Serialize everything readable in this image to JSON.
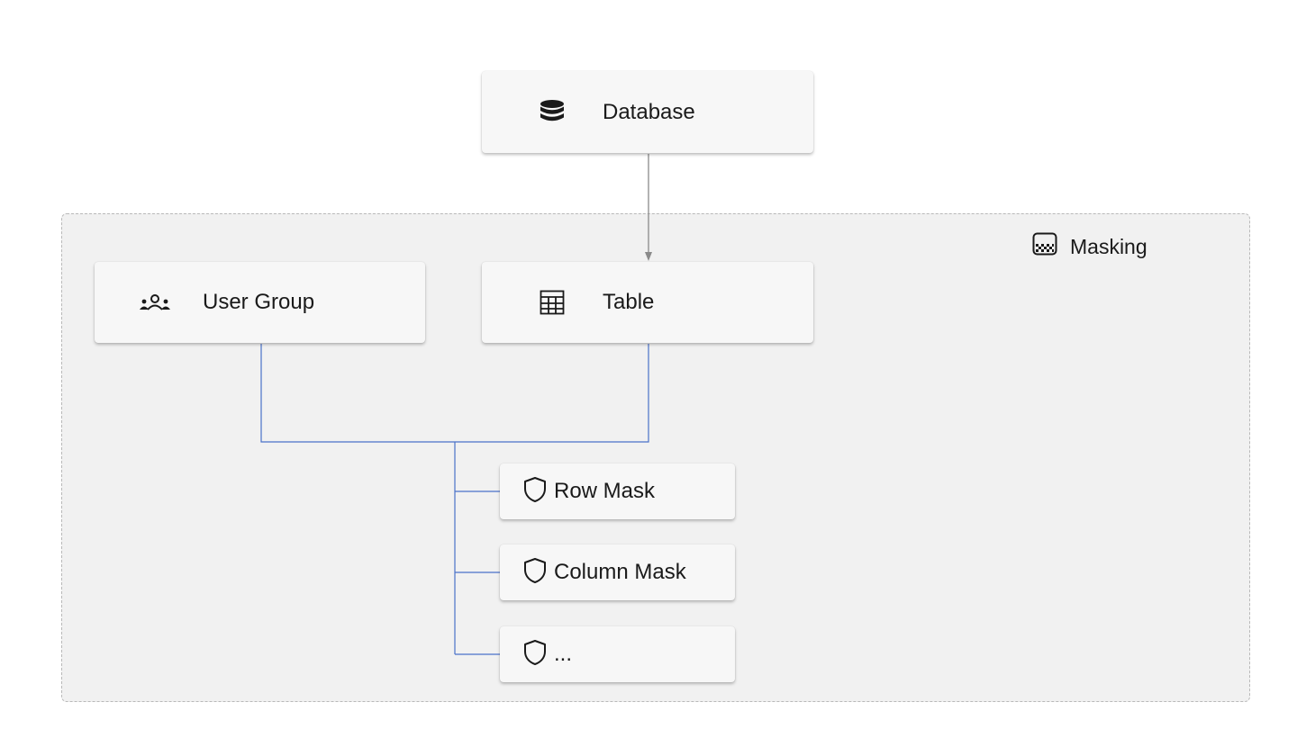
{
  "diagram": {
    "nodes": {
      "database": {
        "label": "Database",
        "icon": "database-icon"
      },
      "user_group": {
        "label": "User Group",
        "icon": "user-group-icon"
      },
      "table": {
        "label": "Table",
        "icon": "table-icon"
      },
      "masks": [
        {
          "label": "Row Mask",
          "icon": "shield-icon"
        },
        {
          "label": "Column Mask",
          "icon": "shield-icon"
        },
        {
          "label": "...",
          "icon": "shield-icon"
        }
      ]
    },
    "group": {
      "label": "Masking",
      "icon": "masking-pattern-icon"
    },
    "colors": {
      "group_background": "#f1f1f1",
      "group_border": "#b9b9b9",
      "arrow": "#8a8a8a",
      "connector": "#4a72c9"
    },
    "edges": [
      {
        "from": "database",
        "to": "table",
        "style": "arrow"
      },
      {
        "from": "user_group",
        "to": "masks",
        "style": "line"
      },
      {
        "from": "table",
        "to": "masks",
        "style": "line"
      }
    ]
  }
}
